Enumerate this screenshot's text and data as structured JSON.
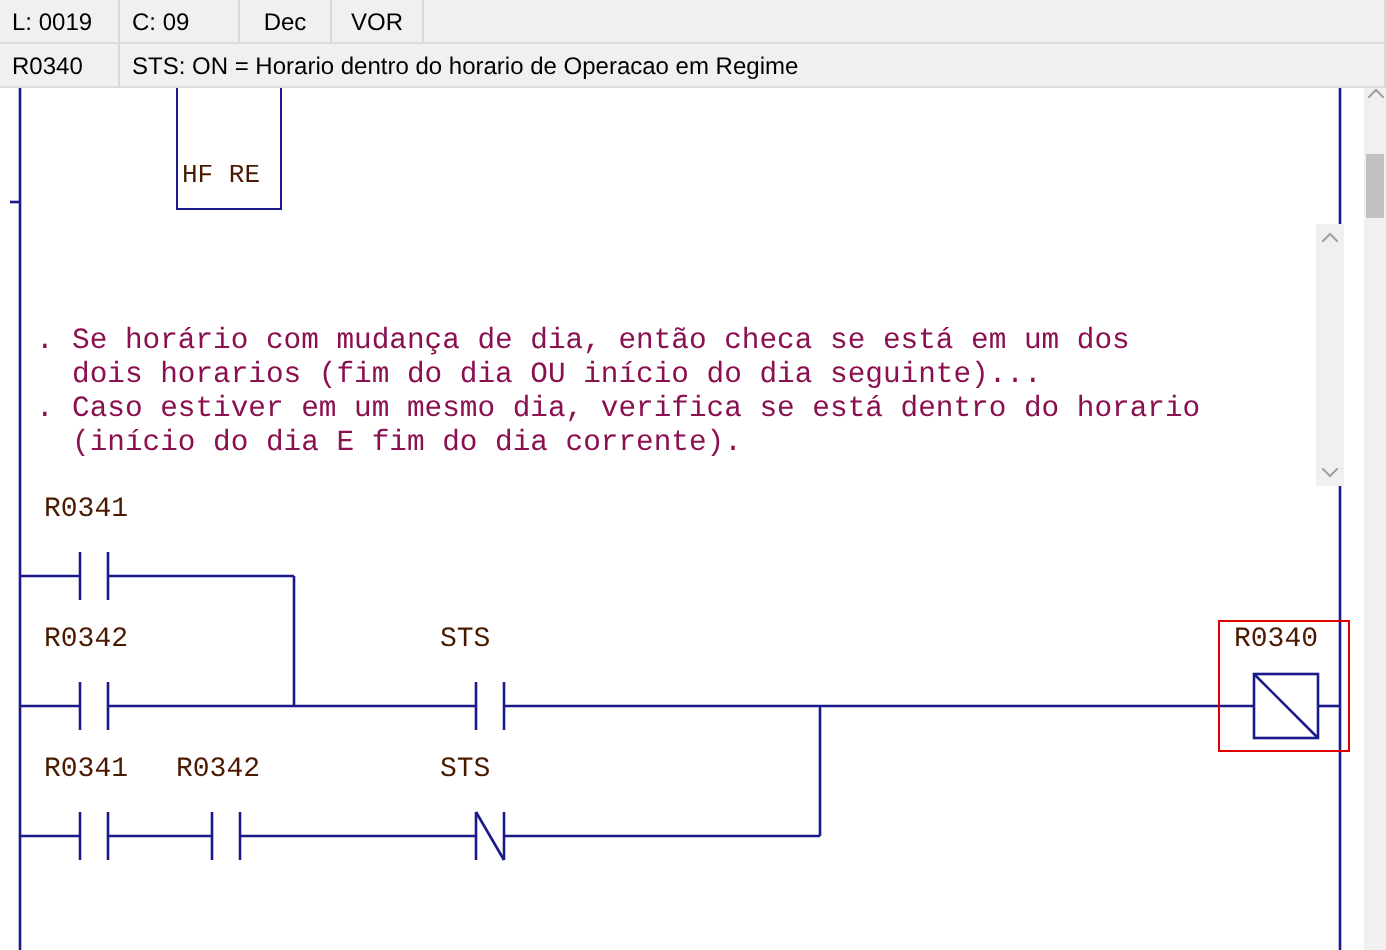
{
  "status_bar": {
    "line": "L: 0019",
    "column": "C: 09",
    "format": "Dec",
    "mode": "VOR"
  },
  "info_bar": {
    "address": "R0340",
    "description": "STS: ON = Horario dentro do horario de Operacao em Regime"
  },
  "function_block": {
    "label": "HF RE"
  },
  "comment": [
    {
      "marker": ".",
      "text": "Se horário com mudança de dia, então checa se está em um dos"
    },
    {
      "text": "dois horarios (fim do dia OU início do dia seguinte)..."
    },
    {
      "marker": ".",
      "text": "Caso estiver em um mesmo dia, verifica se está dentro do horario"
    },
    {
      "text": "(início do dia E fim do dia corrente)."
    }
  ],
  "rungs": [
    {
      "elements": [
        {
          "kind": "contact_no",
          "label": "R0341"
        }
      ]
    },
    {
      "elements": [
        {
          "kind": "contact_no",
          "label": "R0342"
        },
        {
          "kind": "wire"
        },
        {
          "kind": "contact_no",
          "label": "STS"
        },
        {
          "kind": "coil",
          "label": "R0340",
          "selected": true
        }
      ]
    },
    {
      "elements": [
        {
          "kind": "contact_no",
          "label": "R0341"
        },
        {
          "kind": "contact_no",
          "label": "R0342"
        },
        {
          "kind": "contact_nc",
          "label": "STS"
        }
      ]
    }
  ]
}
